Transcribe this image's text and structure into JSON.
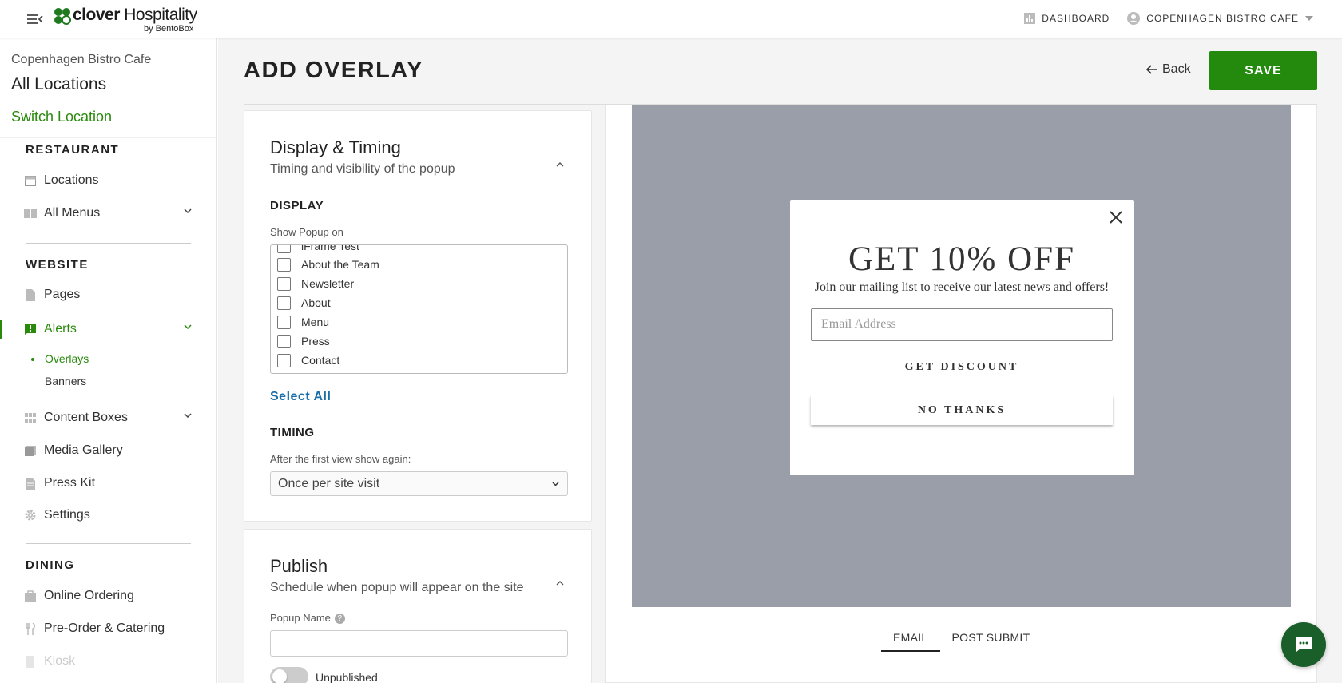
{
  "brand": {
    "name_bold": "clover",
    "name_light": " Hospitality",
    "sub": "by BentoBox",
    "green": "#2a8a0e"
  },
  "topbar": {
    "dashboard_label": "DASHBOARD",
    "account_label": "COPENHAGEN BISTRO CAFE"
  },
  "sidebar": {
    "location_name": "Copenhagen Bistro Cafe",
    "all_locations": "All Locations",
    "switch_location": "Switch Location",
    "sections": {
      "restaurant": "RESTAURANT",
      "website": "WEBSITE",
      "dining": "DINING"
    },
    "items": {
      "locations": "Locations",
      "all_menus": "All Menus",
      "pages": "Pages",
      "alerts": "Alerts",
      "overlays": "Overlays",
      "banners": "Banners",
      "content_boxes": "Content Boxes",
      "media_gallery": "Media Gallery",
      "press_kit": "Press Kit",
      "settings": "Settings",
      "online_ordering": "Online Ordering",
      "pre_order": "Pre-Order & Catering",
      "kiosk": "Kiosk"
    }
  },
  "header": {
    "title": "ADD OVERLAY",
    "back_label": "Back",
    "save_label": "SAVE"
  },
  "display_card": {
    "title": "Display & Timing",
    "subtitle": "Timing and visibility of the popup",
    "display_head": "DISPLAY",
    "show_on_label": "Show Popup on",
    "pages": [
      "iFrame Test",
      "About the Team",
      "Newsletter",
      "About",
      "Menu",
      "Press",
      "Contact"
    ],
    "select_all": "Select All",
    "timing_head": "TIMING",
    "timing_label": "After the first view show again:",
    "timing_value": "Once per site visit"
  },
  "publish_card": {
    "title": "Publish",
    "subtitle": "Schedule when popup will appear on the site",
    "name_label": "Popup Name",
    "name_value": "",
    "toggle_label": "Unpublished"
  },
  "preview": {
    "popup_title": "GET 10% OFF",
    "popup_sub": "Join our mailing list to receive our latest news and offers!",
    "email_placeholder": "Email Address",
    "discount_label": "GET DISCOUNT",
    "no_thanks_label": "NO THANKS",
    "tabs": [
      "EMAIL",
      "POST SUBMIT"
    ]
  }
}
